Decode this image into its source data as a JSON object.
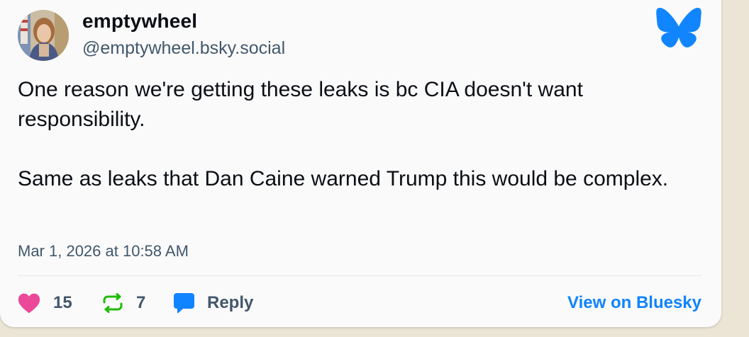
{
  "post": {
    "author": {
      "display_name": "emptywheel",
      "handle": "@emptywheel.bsky.social"
    },
    "text": [
      "One reason we're getting these leaks is bc CIA doesn't want responsibility.",
      "Same as leaks that Dan Caine warned Trump this would be complex."
    ],
    "timestamp": "Mar 1, 2026 at 10:58 AM",
    "likes": "15",
    "reposts": "7",
    "reply_label": "Reply",
    "view_label": "View on Bluesky"
  },
  "icons": {
    "logo": "bluesky-butterfly-icon",
    "like": "heart-icon",
    "repost": "repost-icon",
    "reply": "speech-bubble-icon"
  },
  "colors": {
    "like": "#ec4899",
    "repost": "#20bc07",
    "reply": "#1083fe",
    "link": "#1083fe",
    "brand": "#1185fe"
  }
}
